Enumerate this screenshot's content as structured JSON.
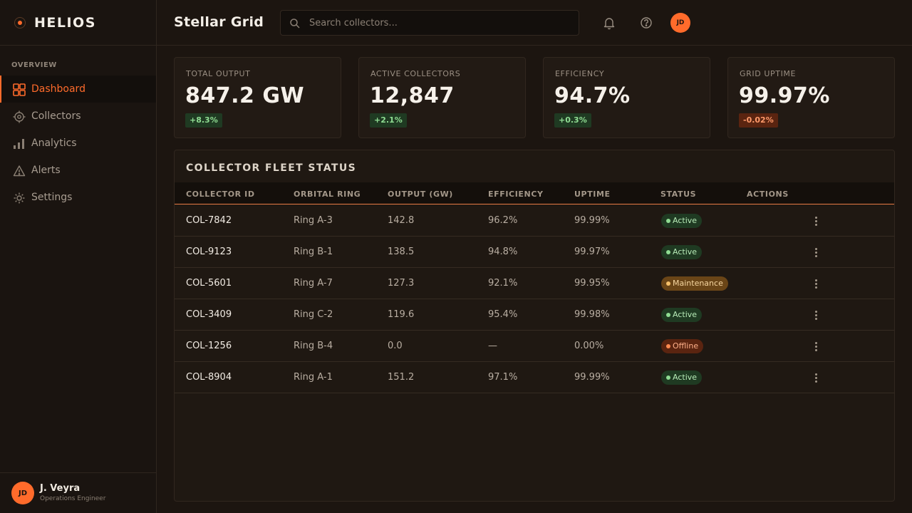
{
  "brand": {
    "name": "HELIOS"
  },
  "sidebar": {
    "section_label": "OVERVIEW",
    "items": [
      {
        "label": "Dashboard",
        "icon": "grid-icon",
        "active": true
      },
      {
        "label": "Collectors",
        "icon": "sun-target-icon",
        "active": false
      },
      {
        "label": "Analytics",
        "icon": "bar-chart-icon",
        "active": false
      },
      {
        "label": "Alerts",
        "icon": "warning-triangle-icon",
        "active": false
      },
      {
        "label": "Settings",
        "icon": "gear-icon",
        "active": false
      }
    ],
    "user": {
      "initials": "JD",
      "name": "J. Veyra",
      "role": "Operations Engineer"
    }
  },
  "header": {
    "title": "Stellar Grid",
    "search": {
      "placeholder": "Search collectors...",
      "value": ""
    },
    "icons": [
      "bell-icon",
      "help-circle-icon"
    ],
    "avatar_initials": "JD"
  },
  "kpis": [
    {
      "label": "TOTAL OUTPUT",
      "value": "847.2 GW",
      "delta": "+8.3%",
      "trend": "up"
    },
    {
      "label": "ACTIVE COLLECTORS",
      "value": "12,847",
      "delta": "+2.1%",
      "trend": "up"
    },
    {
      "label": "EFFICIENCY",
      "value": "94.7%",
      "delta": "+0.3%",
      "trend": "up"
    },
    {
      "label": "GRID UPTIME",
      "value": "99.97%",
      "delta": "-0.02%",
      "trend": "down"
    }
  ],
  "table": {
    "title": "COLLECTOR FLEET STATUS",
    "columns": [
      "COLLECTOR ID",
      "ORBITAL RING",
      "OUTPUT (GW)",
      "EFFICIENCY",
      "UPTIME",
      "STATUS",
      "ACTIONS"
    ],
    "rows": [
      {
        "id": "COL-7842",
        "ring": "Ring A-3",
        "output": "142.8",
        "efficiency": "96.2%",
        "uptime": "99.99%",
        "status": "Active"
      },
      {
        "id": "COL-9123",
        "ring": "Ring B-1",
        "output": "138.5",
        "efficiency": "94.8%",
        "uptime": "99.97%",
        "status": "Active"
      },
      {
        "id": "COL-5601",
        "ring": "Ring A-7",
        "output": "127.3",
        "efficiency": "92.1%",
        "uptime": "99.95%",
        "status": "Maintenance"
      },
      {
        "id": "COL-3409",
        "ring": "Ring C-2",
        "output": "119.6",
        "efficiency": "95.4%",
        "uptime": "99.98%",
        "status": "Active"
      },
      {
        "id": "COL-1256",
        "ring": "Ring B-4",
        "output": "0.0",
        "efficiency": "—",
        "uptime": "0.00%",
        "status": "Offline"
      },
      {
        "id": "COL-8904",
        "ring": "Ring A-1",
        "output": "151.2",
        "efficiency": "97.1%",
        "uptime": "99.99%",
        "status": "Active"
      }
    ]
  },
  "colors": {
    "accent": "#ff6b2b",
    "background": "#1c1510",
    "active_status": "#8fdc92",
    "maintenance_status": "#f6c06a",
    "offline_status": "#ff8a50"
  }
}
